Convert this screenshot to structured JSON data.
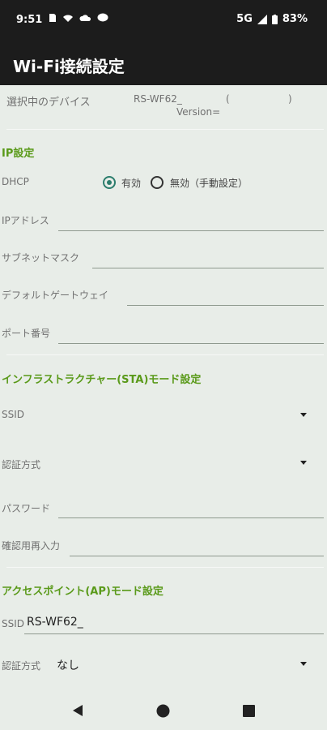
{
  "status": {
    "time": "9:51",
    "network": "5G",
    "battery": "83%"
  },
  "appbar": {
    "title": "Wi-Fi接続設定"
  },
  "device": {
    "label": "選択中のデバイス",
    "name": "RS-WF62_",
    "paren_open": "(",
    "paren_close": ")",
    "version": "Version="
  },
  "ip": {
    "section": "IP設定",
    "dhcp_label": "DHCP",
    "dhcp_on": "有効",
    "dhcp_off": "無効（手動設定）",
    "dhcp_selected": "有効",
    "address_label": "IPアドレス",
    "subnet_label": "サブネットマスク",
    "gateway_label": "デフォルトゲートウェイ",
    "port_label": "ポート番号"
  },
  "sta": {
    "section": "インフラストラクチャー(STA)モード設定",
    "ssid_label": "SSID",
    "auth_label": "認証方式",
    "password_label": "パスワード",
    "confirm_label": "確認用再入力"
  },
  "ap": {
    "section": "アクセスポイント(AP)モード設定",
    "ssid_label": "SSID",
    "ssid_value": "RS-WF62_",
    "auth_label": "認証方式",
    "auth_value": "なし"
  }
}
